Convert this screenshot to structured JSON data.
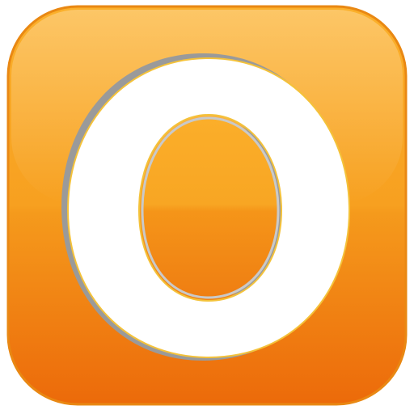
{
  "icon": {
    "name": "app-icon",
    "glyph": "letter-o-icon",
    "colors": {
      "orange_top": "#fbb02b",
      "orange_mid": "#f7a020",
      "orange_bottom": "#ec6a0a",
      "border": "#e98813",
      "highlight": "#fff6e0",
      "glyph_fill": "#ffffff",
      "glyph_shadow": "#9a9a9a",
      "glyph_rim": "#f4c23a"
    }
  }
}
